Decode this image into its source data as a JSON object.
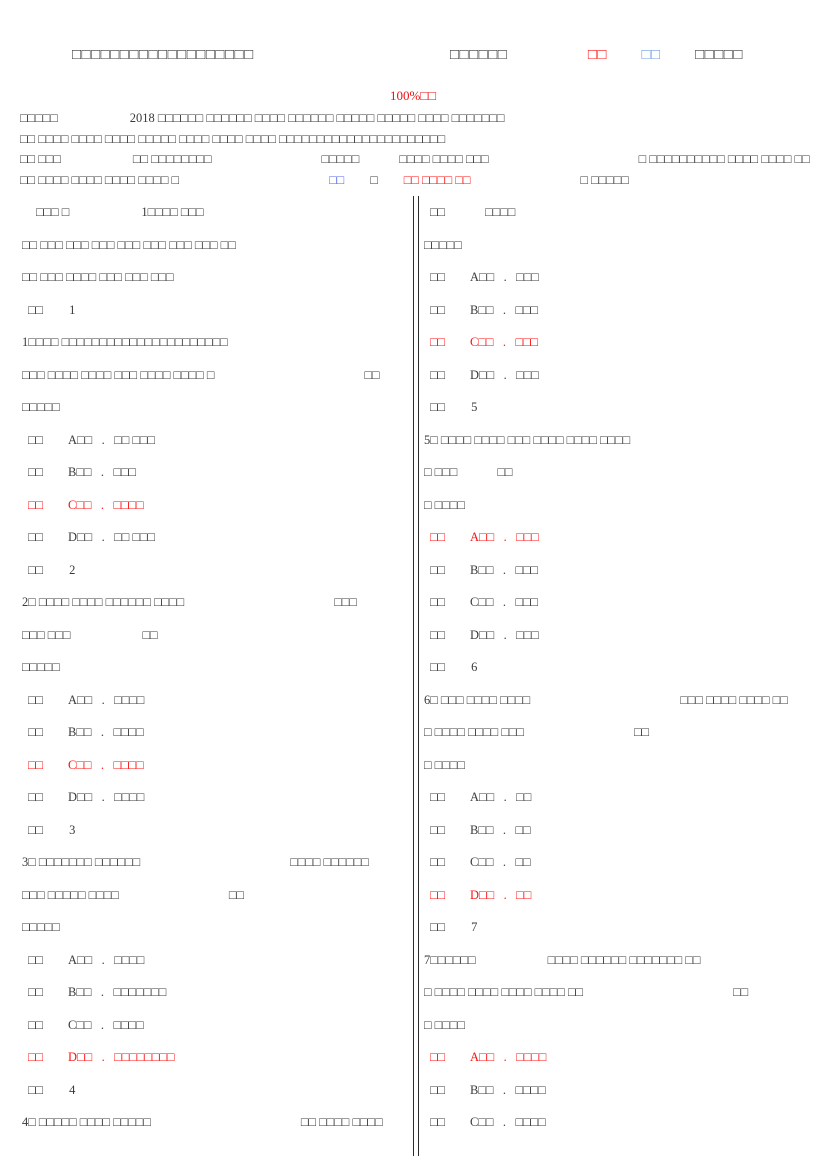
{
  "document": {
    "tofu": "　",
    "header": {
      "title": "□□□□□□□□□□□□□□□□□□□",
      "meta_label": "□□□□□□",
      "meta_red": "□□",
      "meta_blue": "□□",
      "meta_tail": "□□□□□"
    },
    "percent_line": "100%□□",
    "intro_lines": [
      {
        "segments": [
          {
            "text": "□□□□□",
            "color": "black"
          },
          {
            "gap": "gap-lg"
          },
          {
            "text": "2018 □□□□□□ □□□□□□ □□□□ □□□□□□ □□□□□ □□□□□ □□□□ □□□□□□□",
            "color": "black"
          }
        ]
      },
      {
        "segments": [
          {
            "text": "□□ □□□□ □□□□ □□□□ □□□□□ □□□□ □□□□ □□□□ □□□□□□□□□□□□□□□□□□□□□□",
            "color": "black"
          }
        ]
      },
      {
        "segments": [
          {
            "text": "□□ □□□",
            "color": "black"
          },
          {
            "gap": "gap-lg"
          },
          {
            "text": "□□ □□□□□□□□",
            "color": "black"
          },
          {
            "gap": "gap-xl"
          },
          {
            "text": "□□□□□",
            "color": "black"
          },
          {
            "gap": "gap-md"
          },
          {
            "text": "□□□□ □□□□ □□□",
            "color": "black"
          },
          {
            "gap": "gap-xxl"
          },
          {
            "text": "□ □□□□□□□□□□ □□□□ □□□□ □□",
            "color": "black"
          }
        ]
      },
      {
        "segments": [
          {
            "text": "□□ □□□□ □□□□ □□□□ □□□□ □",
            "color": "black"
          },
          {
            "gap": "gap-xxl"
          },
          {
            "text": "□□",
            "color": "blue-dk"
          },
          {
            "gap": "gap-sm"
          },
          {
            "text": "□",
            "color": "black"
          },
          {
            "gap": "gap-sm"
          },
          {
            "text": "□□ □□□□ □□",
            "color": "red"
          },
          {
            "gap": "gap-xl"
          },
          {
            "text": "□ □□□□□",
            "color": "black"
          }
        ]
      }
    ],
    "left_column": [
      {
        "type": "heading",
        "text": "□□□ □",
        "gap": "gap-lg",
        "tail": "1□□□□ □□□"
      },
      {
        "type": "text",
        "text": "□□ □□□ □□□ □□□ □□□ □□□ □□□ □□□ □□"
      },
      {
        "type": "text",
        "text": "□□ □□□ □□□□ □□□ □□□ □□□"
      },
      {
        "type": "qlabel",
        "prefix": "□□",
        "number": "1"
      },
      {
        "type": "qtext",
        "text": "1□□□□ □□□□□□□□□□□□□□□□□□□□□□"
      },
      {
        "type": "qtext2",
        "text": "□□□ □□□□ □□□□ □□□ □□□□ □□□□ □",
        "gap": "gap-xxl",
        "tail": "□□"
      },
      {
        "type": "text",
        "text": "□□□□□"
      },
      {
        "type": "option",
        "letter": "A",
        "text": "□□ □□□",
        "correct": false
      },
      {
        "type": "option",
        "letter": "B",
        "text": "□□□",
        "correct": false
      },
      {
        "type": "option",
        "letter": "C",
        "text": "□□□□",
        "correct": true
      },
      {
        "type": "option",
        "letter": "D",
        "text": "□□ □□□",
        "correct": false
      },
      {
        "type": "qlabel",
        "prefix": "□□",
        "number": "2"
      },
      {
        "type": "qtext2",
        "text": "2□ □□□□ □□□□ □□□□□□ □□□□",
        "gap": "gap-xxl",
        "tail": "□□□"
      },
      {
        "type": "qtext2",
        "text": "□□□ □□□",
        "gap": "gap-lg",
        "tail": "□□"
      },
      {
        "type": "text",
        "text": "□□□□□"
      },
      {
        "type": "option",
        "letter": "A",
        "text": "□□□□",
        "correct": false
      },
      {
        "type": "option",
        "letter": "B",
        "text": "□□□□",
        "correct": false
      },
      {
        "type": "option",
        "letter": "C",
        "text": "□□□□",
        "correct": true
      },
      {
        "type": "option",
        "letter": "D",
        "text": "□□□□",
        "correct": false
      },
      {
        "type": "qlabel",
        "prefix": "□□",
        "number": "3"
      },
      {
        "type": "qtext2",
        "text": "3□ □□□□□□□ □□□□□□",
        "gap": "gap-xxl",
        "tail": "□□□□ □□□□□□"
      },
      {
        "type": "qtext2",
        "text": "□□□ □□□□□ □□□□",
        "gap": "gap-xl",
        "tail": "□□"
      },
      {
        "type": "text",
        "text": "□□□□□"
      },
      {
        "type": "option",
        "letter": "A",
        "text": "□□□□",
        "correct": false
      },
      {
        "type": "option",
        "letter": "B",
        "text": "□□□□□□□",
        "correct": false
      },
      {
        "type": "option",
        "letter": "C",
        "text": "□□□□",
        "correct": false
      },
      {
        "type": "option",
        "letter": "D",
        "text": "□□□□□□□□",
        "correct": true
      },
      {
        "type": "qlabel",
        "prefix": "□□",
        "number": "4"
      },
      {
        "type": "qtext2",
        "text": "4□ □□□□□ □□□□ □□□□□",
        "gap": "gap-xxl",
        "tail": "□□ □□□□ □□□□"
      }
    ],
    "right_column": [
      {
        "type": "heading2",
        "text": "□□",
        "gap": "gap-md",
        "tail": "□□□□"
      },
      {
        "type": "text",
        "text": "□□□□□"
      },
      {
        "type": "option",
        "letter": "A",
        "text": "□□□",
        "correct": false
      },
      {
        "type": "option",
        "letter": "B",
        "text": "□□□",
        "correct": false
      },
      {
        "type": "option",
        "letter": "C",
        "text": "□□□",
        "correct": true
      },
      {
        "type": "option",
        "letter": "D",
        "text": "□□□",
        "correct": false
      },
      {
        "type": "qlabel",
        "prefix": "□□",
        "number": "5"
      },
      {
        "type": "qtext",
        "text": "5□ □□□□ □□□□ □□□ □□□□ □□□□ □□□□"
      },
      {
        "type": "qtext2",
        "text": "□ □□□",
        "gap": "gap-md",
        "tail": "□□"
      },
      {
        "type": "text",
        "text": "□ □□□□"
      },
      {
        "type": "option",
        "letter": "A",
        "text": "□□□",
        "correct": true
      },
      {
        "type": "option",
        "letter": "B",
        "text": "□□□",
        "correct": false
      },
      {
        "type": "option",
        "letter": "C",
        "text": "□□□",
        "correct": false
      },
      {
        "type": "option",
        "letter": "D",
        "text": "□□□",
        "correct": false
      },
      {
        "type": "qlabel",
        "prefix": "□□",
        "number": "6"
      },
      {
        "type": "qtext2",
        "text": "6□ □□□ □□□□ □□□□",
        "gap": "gap-xxl",
        "tail": "□□□ □□□□ □□□□ □□"
      },
      {
        "type": "qtext2",
        "text": "□ □□□□ □□□□ □□□",
        "gap": "gap-xl",
        "tail": "□□"
      },
      {
        "type": "text",
        "text": "□ □□□□"
      },
      {
        "type": "option",
        "letter": "A",
        "text": "□□",
        "correct": false
      },
      {
        "type": "option",
        "letter": "B",
        "text": "□□",
        "correct": false
      },
      {
        "type": "option",
        "letter": "C",
        "text": "□□",
        "correct": false
      },
      {
        "type": "option",
        "letter": "D",
        "text": "□□",
        "correct": true
      },
      {
        "type": "qlabel",
        "prefix": "□□",
        "number": "7"
      },
      {
        "type": "qtext2",
        "text": "7□□□□□□",
        "gap": "gap-lg",
        "tail": "□□□□ □□□□□□ □□□□□□□ □□"
      },
      {
        "type": "qtext2",
        "text": "□ □□□□ □□□□ □□□□ □□□□ □□",
        "gap": "gap-xxl",
        "tail": "□□"
      },
      {
        "type": "text",
        "text": "□ □□□□"
      },
      {
        "type": "option",
        "letter": "A",
        "text": "□□□□",
        "correct": true
      },
      {
        "type": "option",
        "letter": "B",
        "text": "□□□□",
        "correct": false
      },
      {
        "type": "option",
        "letter": "C",
        "text": "□□□□",
        "correct": false
      }
    ],
    "colors": {
      "red": "#fc1111",
      "blue": "#6d9fe0",
      "blue_dark": "#5566ee",
      "text": "#3a3a3a",
      "divider": "#2b2b2b"
    }
  }
}
